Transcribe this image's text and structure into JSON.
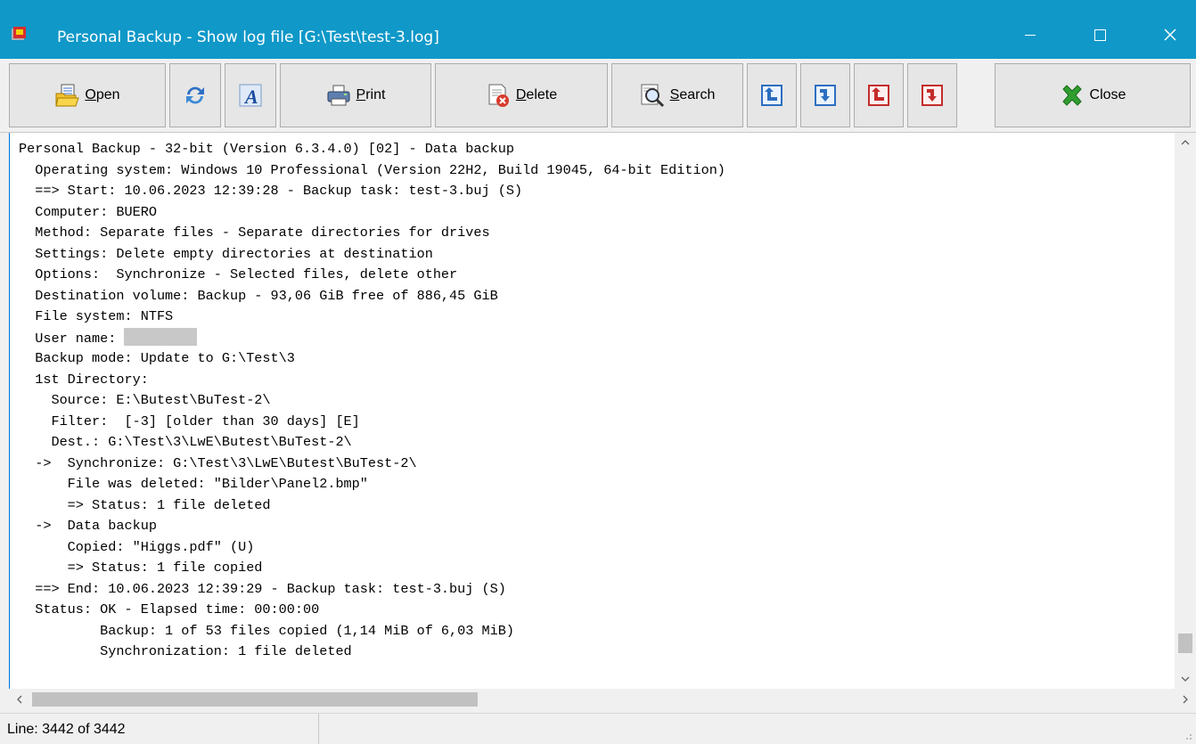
{
  "window": {
    "title": "Personal Backup - Show log file [G:\\Test\\test-3.log]",
    "min_icon": "minimize-icon",
    "max_icon": "maximize-icon",
    "close_icon": "close-window-icon"
  },
  "toolbar": {
    "open": {
      "label": "Open",
      "accel": "O",
      "icon": "folder-open-icon"
    },
    "refresh": {
      "icon": "refresh-icon"
    },
    "font": {
      "icon": "font-icon"
    },
    "print": {
      "label": "Print",
      "accel": "P",
      "icon": "printer-icon"
    },
    "delete": {
      "label": "Delete",
      "accel": "D",
      "icon": "delete-file-icon"
    },
    "search": {
      "label": "Search",
      "accel": "S",
      "icon": "search-icon"
    },
    "nav1": {
      "icon": "jump-up-blue-icon"
    },
    "nav2": {
      "icon": "jump-down-blue-icon"
    },
    "nav3": {
      "icon": "jump-up-red-icon"
    },
    "nav4": {
      "icon": "jump-down-red-icon"
    },
    "close": {
      "label": "Close",
      "icon": "close-green-x-icon"
    }
  },
  "log": {
    "lines": [
      "Personal Backup - 32-bit (Version 6.3.4.0) [02] - Data backup",
      "  Operating system: Windows 10 Professional (Version 22H2, Build 19045, 64-bit Edition)",
      "  ==> Start: 10.06.2023 12:39:28 - Backup task: test-3.buj (S)",
      "  Computer: BUERO",
      "  Method: Separate files - Separate directories for drives",
      "  Settings: Delete empty directories at destination",
      "  Options:  Synchronize - Selected files, delete other",
      "  Destination volume: Backup - 93,06 GiB free of 886,45 GiB",
      "  File system: NTFS",
      "  User name: ",
      "  Backup mode: Update to G:\\Test\\3",
      "  1st Directory:",
      "    Source: E:\\Butest\\BuTest-2\\",
      "    Filter:  [-3] [older than 30 days] [E]",
      "    Dest.: G:\\Test\\3\\LwE\\Butest\\BuTest-2\\",
      "  ->  Synchronize: G:\\Test\\3\\LwE\\Butest\\BuTest-2\\",
      "      File was deleted: \"Bilder\\Panel2.bmp\"",
      "      => Status: 1 file deleted",
      "  ->  Data backup",
      "      Copied: \"Higgs.pdf\" (U)",
      "      => Status: 1 file copied",
      "  ==> End: 10.06.2023 12:39:29 - Backup task: test-3.buj (S)",
      "  Status: OK - Elapsed time: 00:00:00",
      "          Backup: 1 of 53 files copied (1,14 MiB of 6,03 MiB)",
      "          Synchronization: 1 file deleted"
    ]
  },
  "status": {
    "line_info": "Line: 3442 of 3442"
  }
}
